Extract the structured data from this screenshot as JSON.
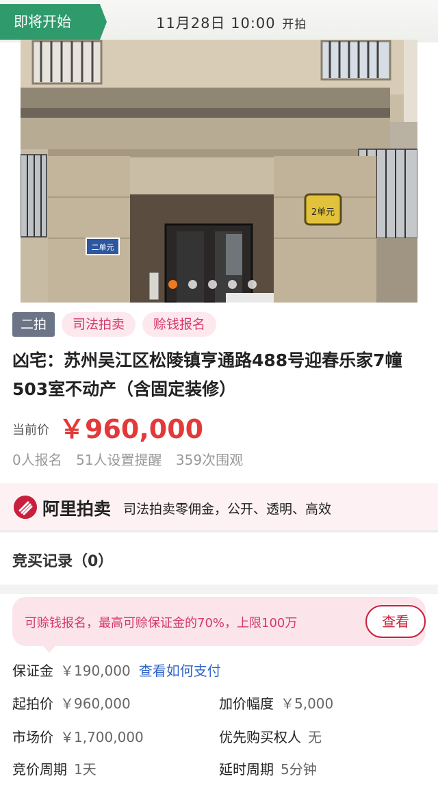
{
  "status_bar": {
    "status_tag": "即将开始",
    "start_time": "11月28日 10:00",
    "start_suffix": "开拍"
  },
  "hero": {
    "image_alt": "building entrance photo",
    "unit_sign_left": "二单元",
    "unit_sign_right": "2单元",
    "carousel_total": 5,
    "carousel_active": 1
  },
  "tags": [
    "二拍",
    "司法拍卖",
    "赊钱报名"
  ],
  "title": "凶宅：苏州吴江区松陵镇亨通路488号迎春乐家7幢503室不动产（含固定装修）",
  "price": {
    "label": "当前价",
    "value": "￥960,000"
  },
  "stats": {
    "signups": "0人报名",
    "reminders": "51人设置提醒",
    "views": "359次围观"
  },
  "ali_banner": {
    "brand": "阿里拍卖",
    "slogan": "司法拍卖零佣金，公开、透明、高效"
  },
  "records": {
    "title": "竞买记录（0）"
  },
  "notice": {
    "text": "可赊钱报名，最高可赊保证金的70%，上限100万",
    "button": "查看"
  },
  "details": {
    "deposit_label": "保证金",
    "deposit_value": "￥190,000",
    "deposit_link": "查看如何支付",
    "start_price_label": "起拍价",
    "start_price_value": "￥960,000",
    "increment_label": "加价幅度",
    "increment_value": "￥5,000",
    "market_price_label": "市场价",
    "market_price_value": "￥1,700,000",
    "priority_label": "优先购买权人",
    "priority_value": "无",
    "cycle_label": "竞价周期",
    "cycle_value": "1天",
    "extension_label": "延时周期",
    "extension_value": "5分钟"
  },
  "colors": {
    "status_green": "#2f9a6b",
    "price_red": "#e23a3a",
    "accent_pink": "#d4396a",
    "link_blue": "#2f66c8"
  }
}
